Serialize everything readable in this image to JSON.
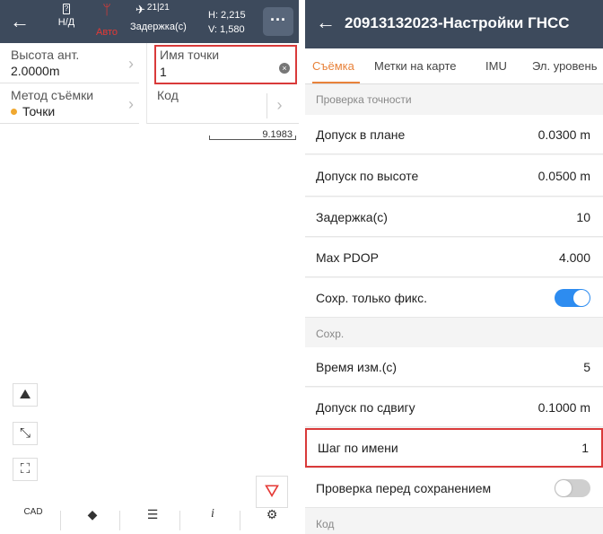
{
  "left": {
    "topbar": {
      "battery_label": "Н/Д",
      "battery_glyph": "?",
      "antenna_label": "Авто",
      "sat_count": "21|21",
      "delay_label": "Задержка(с)",
      "h_value": "H: 2,215",
      "v_value": "V: 1,580",
      "more_label": "···"
    },
    "fields": {
      "antenna_height": {
        "label": "Высота ант.",
        "value": "2.0000m"
      },
      "point_name": {
        "label": "Имя точки",
        "value": "1"
      },
      "survey_method": {
        "label": "Метод съёмки",
        "value": "Точки"
      },
      "code": {
        "label": "Код",
        "value": ""
      }
    },
    "scale_value": "9.1983",
    "colors": {
      "bar": "#3d4a5c",
      "accent": "#e53935",
      "dot": "#f0a830"
    }
  },
  "right": {
    "title": "20913132023-Настройки ГНСС",
    "tabs": [
      "Съёмка",
      "Метки на карте",
      "IMU",
      "Эл. уровень"
    ],
    "active_tab": 0,
    "sections": {
      "accuracy": "Проверка точности",
      "save": "Сохр.",
      "code": "Код"
    },
    "rows": {
      "h_tolerance": {
        "label": "Допуск в плане",
        "value": "0.0300 m"
      },
      "v_tolerance": {
        "label": "Допуск по высоте",
        "value": "0.0500 m"
      },
      "delay": {
        "label": "Задержка(с)",
        "value": "10"
      },
      "pdop": {
        "label": "Max PDOP",
        "value": "4.000"
      },
      "fixed_only": {
        "label": "Сохр. только фикс.",
        "enabled": true
      },
      "meas_time": {
        "label": "Время изм.(с)",
        "value": "5"
      },
      "shift_tol": {
        "label": "Допуск по сдвигу",
        "value": "0.1000 m"
      },
      "name_step": {
        "label": "Шаг по имени",
        "value": "1"
      },
      "check_before_save": {
        "label": "Проверка перед сохранением",
        "enabled": false
      }
    },
    "colors": {
      "bar": "#3d4a5c",
      "tab_active": "#e8823a",
      "toggle_on": "#2d8cf0",
      "highlight": "#d93a3a"
    }
  }
}
